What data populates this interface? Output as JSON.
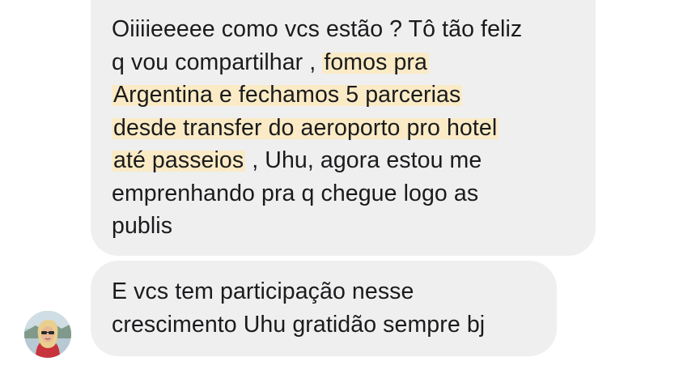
{
  "messages": [
    {
      "lines": [
        {
          "text": "Oiiiieeeee como vcs estão ? Tô tão feliz"
        },
        {
          "plain": "q vou compartilhar , ",
          "highlight": "fomos pra"
        },
        {
          "highlight": "Argentina e fechamos 5 parcerias"
        },
        {
          "highlight": "desde transfer do aeroporto pro hotel"
        },
        {
          "highlight": "até passeios",
          "plain": " , Uhu, agora estou me"
        },
        {
          "text": "emprenhando pra q chegue logo as"
        },
        {
          "text": "publis"
        }
      ]
    },
    {
      "lines": [
        {
          "text": "E vcs tem participação nesse"
        },
        {
          "text": "crescimento Uhu gratidão sempre bj"
        }
      ]
    }
  ],
  "colors": {
    "bubble_background": "#efeff0",
    "highlight": "#faebc6",
    "text": "#1b1b1d",
    "page_background": "#ffffff"
  },
  "icons": {
    "avatar": "sender-avatar-photo"
  }
}
